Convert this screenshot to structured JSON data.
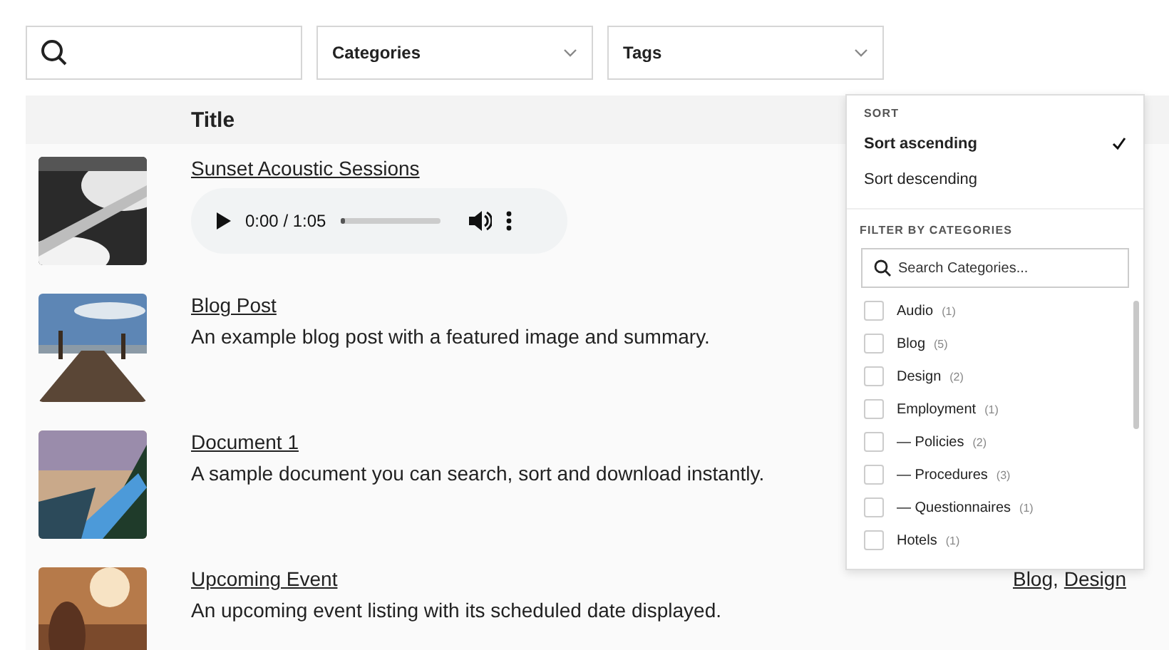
{
  "filters": {
    "dropdowns": [
      {
        "label": "Categories"
      },
      {
        "label": "Tags"
      }
    ]
  },
  "table": {
    "columns": [
      "Title"
    ],
    "rows": [
      {
        "title": "Sunset Acoustic Sessions",
        "kind": "audio",
        "audio": {
          "time": "0:00 / 1:05",
          "level": 0.05
        }
      },
      {
        "title": "Blog Post",
        "kind": "text",
        "description": "An example blog post with a featured image and summary."
      },
      {
        "title": "Document 1",
        "kind": "text",
        "description": "A sample document you can search, sort and download instantly."
      },
      {
        "title": "Upcoming Event",
        "kind": "text",
        "description": "An upcoming event listing with its scheduled date displayed.",
        "categories": [
          {
            "label": "Blog",
            "separator": ","
          },
          {
            "label": "Design"
          }
        ]
      }
    ]
  },
  "menu": {
    "sort_heading": "SORT",
    "sort_options": [
      {
        "label": "Sort ascending",
        "selected": true
      },
      {
        "label": "Sort descending",
        "selected": false
      }
    ],
    "filter_heading": "FILTER BY CATEGORIES",
    "search": {
      "placeholder": "Search Categories..."
    },
    "categories": [
      {
        "label": "Audio",
        "count": "(1)",
        "checked": false
      },
      {
        "label": "Blog",
        "count": "(5)",
        "checked": false
      },
      {
        "label": "Design",
        "count": "(2)",
        "checked": false
      },
      {
        "label": "Employment",
        "count": "(1)",
        "checked": false,
        "children": [
          {
            "label": "— Policies",
            "count": "(2)",
            "checked": false
          },
          {
            "label": "— Procedures",
            "count": "(3)",
            "checked": false
          },
          {
            "label": "— Questionnaires",
            "count": "(1)",
            "checked": false
          }
        ]
      },
      {
        "label": "Hotels",
        "count": "(1)",
        "checked": false
      }
    ]
  }
}
